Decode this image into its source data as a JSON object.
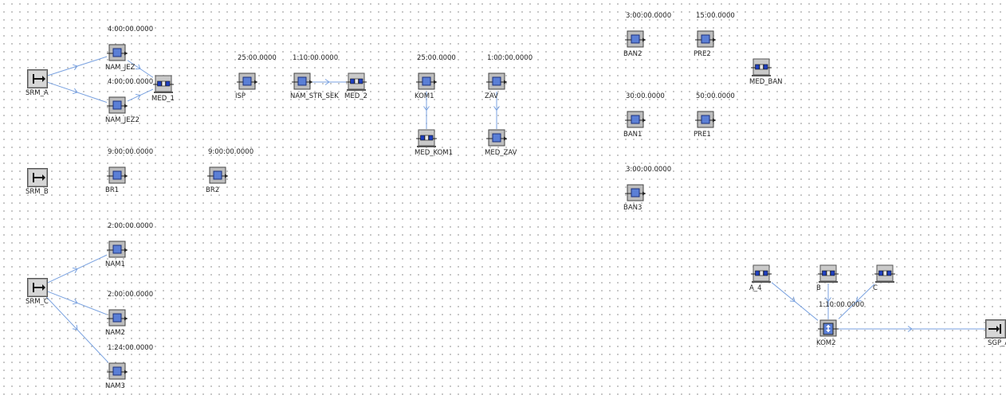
{
  "colors": {
    "connector": "#7aa2e0",
    "block_fill": "#8a8a8a",
    "block_face": "#c9c9c9",
    "element_blue": "#5b7fd6",
    "queue_blue": "#1f3fbf"
  },
  "objects": [
    {
      "id": "SRM_A",
      "kind": "source",
      "label": "SRM_A",
      "time": ""
    },
    {
      "id": "NAM_JEZ",
      "kind": "station",
      "label": "NAM_JEZ",
      "time": "4:00:00.0000"
    },
    {
      "id": "NAM_JEZ2",
      "kind": "station",
      "label": "NAM_JEZ2",
      "time": "4:00:00.0000"
    },
    {
      "id": "MED_1",
      "kind": "buffer",
      "label": "MED_1",
      "time": ""
    },
    {
      "id": "ISP",
      "kind": "station",
      "label": "ISP",
      "time": "25:00.0000"
    },
    {
      "id": "NAM_STR_SEK",
      "kind": "station",
      "label": "NAM_STR_SEK",
      "time": "1:10:00.0000"
    },
    {
      "id": "MED_2",
      "kind": "buffer",
      "label": "MED_2",
      "time": ""
    },
    {
      "id": "KOM1",
      "kind": "station",
      "label": "KOM1",
      "time": "25:00.0000"
    },
    {
      "id": "ZAV",
      "kind": "station",
      "label": "ZAV",
      "time": "1:00:00.0000"
    },
    {
      "id": "MED_KOM1",
      "kind": "buffer",
      "label": "MED_KOM1",
      "time": ""
    },
    {
      "id": "MED_ZAV",
      "kind": "station",
      "label": "MED_ZAV",
      "time": ""
    },
    {
      "id": "BAN2",
      "kind": "station",
      "label": "BAN2",
      "time": "3:00:00.0000"
    },
    {
      "id": "PRE2",
      "kind": "station",
      "label": "PRE2",
      "time": "15:00.0000"
    },
    {
      "id": "MED_BAN",
      "kind": "buffer",
      "label": "MED_BAN",
      "time": ""
    },
    {
      "id": "BAN1",
      "kind": "station",
      "label": "BAN1",
      "time": "30:00.0000"
    },
    {
      "id": "PRE1",
      "kind": "station",
      "label": "PRE1",
      "time": "50:00.0000"
    },
    {
      "id": "BAN3",
      "kind": "station",
      "label": "BAN3",
      "time": "3:00:00.0000"
    },
    {
      "id": "SRM_B",
      "kind": "source",
      "label": "SRM_B",
      "time": ""
    },
    {
      "id": "BR1",
      "kind": "station",
      "label": "BR1",
      "time": "9:00:00.0000"
    },
    {
      "id": "BR2",
      "kind": "station",
      "label": "BR2",
      "time": "9:00:00.0000"
    },
    {
      "id": "SRM_C",
      "kind": "source",
      "label": "SRM_C",
      "time": ""
    },
    {
      "id": "NAM1",
      "kind": "station",
      "label": "NAM1",
      "time": "2:00:00.0000"
    },
    {
      "id": "NAM2",
      "kind": "station",
      "label": "NAM2",
      "time": "2:00:00.0000"
    },
    {
      "id": "NAM3",
      "kind": "station",
      "label": "NAM3",
      "time": "1:24:00.0000"
    },
    {
      "id": "A_4",
      "kind": "buffer",
      "label": "A_4",
      "time": ""
    },
    {
      "id": "B",
      "kind": "buffer",
      "label": "B",
      "time": ""
    },
    {
      "id": "C",
      "kind": "buffer",
      "label": "C",
      "time": ""
    },
    {
      "id": "KOM2",
      "kind": "assembly",
      "label": "KOM2",
      "time": "1:10:00.0000"
    },
    {
      "id": "SGP_A",
      "kind": "drain",
      "label": "SGP_A",
      "time": ""
    }
  ],
  "connectors": [
    {
      "from": "SRM_A",
      "to": "NAM_JEZ"
    },
    {
      "from": "SRM_A",
      "to": "NAM_JEZ2"
    },
    {
      "from": "NAM_JEZ",
      "to": "MED_1"
    },
    {
      "from": "NAM_JEZ2",
      "to": "MED_1"
    },
    {
      "from": "NAM_STR_SEK",
      "to": "MED_2"
    },
    {
      "from": "KOM1",
      "to": "MED_KOM1"
    },
    {
      "from": "ZAV",
      "to": "MED_ZAV"
    },
    {
      "from": "SRM_C",
      "to": "NAM1"
    },
    {
      "from": "SRM_C",
      "to": "NAM2"
    },
    {
      "from": "SRM_C",
      "to": "NAM3"
    },
    {
      "from": "A_4",
      "to": "KOM2"
    },
    {
      "from": "B",
      "to": "KOM2"
    },
    {
      "from": "C",
      "to": "KOM2"
    },
    {
      "from": "KOM2",
      "to": "SGP_A"
    }
  ]
}
